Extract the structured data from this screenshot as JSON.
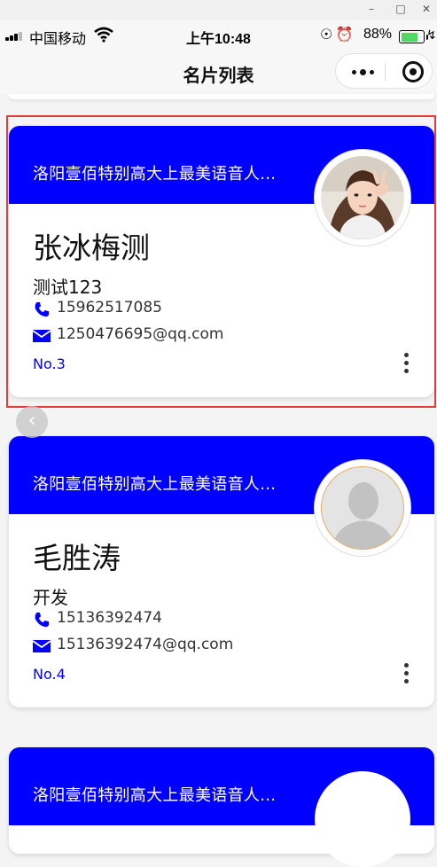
{
  "status_bar": {
    "carrier": "中国移动",
    "time": "上午10:48",
    "battery_percent": "88%",
    "battery_level": 0.88
  },
  "nav": {
    "title": "名片列表"
  },
  "colors": {
    "brand_blue": "#0000ff",
    "highlight_red": "#e43b3b"
  },
  "cards": [
    {
      "company": "洛阳壹佰特别高大上最美语音人...",
      "name": "张冰梅测",
      "title": "测试123",
      "phone": "15962517085",
      "email": "1250476695@qq.com",
      "number": "No.3",
      "avatar": "photo-avatar"
    },
    {
      "company": "洛阳壹佰特别高大上最美语音人...",
      "name": "毛胜涛",
      "title": "开发",
      "phone": "15136392474",
      "email": "15136392474@qq.com",
      "number": "No.4",
      "avatar": "placeholder-person-avatar"
    },
    {
      "company": "洛阳壹佰特别高大上最美语音人...",
      "avatar": "blank-avatar"
    }
  ]
}
